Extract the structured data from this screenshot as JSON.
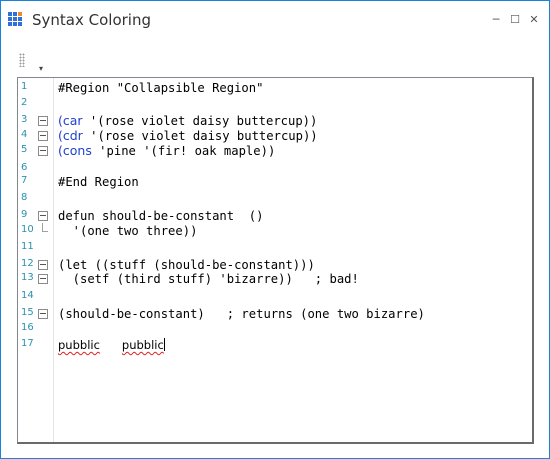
{
  "window": {
    "title": "Syntax Coloring",
    "minimize": "─",
    "maximize": "☐",
    "close": "✕"
  },
  "toolbar": {
    "overflow_icon": "▾"
  },
  "editor": {
    "lines": [
      {
        "n": "1",
        "text": "#Region \"Collapsible Region\""
      },
      {
        "n": "2",
        "text": ""
      },
      {
        "n": "3",
        "kw": "(car",
        "text": " '(rose violet daisy buttercup))"
      },
      {
        "n": "4",
        "kw": "(cdr",
        "text": " '(rose violet daisy buttercup))"
      },
      {
        "n": "5",
        "kw": "(cons",
        "text": " 'pine '(fir! oak maple))"
      },
      {
        "n": "6",
        "text": ""
      },
      {
        "n": "7",
        "text": "#End Region"
      },
      {
        "n": "8",
        "text": ""
      },
      {
        "n": "9",
        "text": "defun should-be-constant  ()"
      },
      {
        "n": "10",
        "text": "  '(one two three))"
      },
      {
        "n": "11",
        "text": ""
      },
      {
        "n": "12",
        "text": "(let ((stuff (should-be-constant)))"
      },
      {
        "n": "13",
        "text": "  (setf (third stuff) 'bizarre))   ; bad!"
      },
      {
        "n": "14",
        "text": ""
      },
      {
        "n": "15",
        "text": "(should-be-constant)   ; returns (one two bizarre)"
      },
      {
        "n": "16",
        "text": ""
      },
      {
        "n": "17",
        "w1": "pubblic",
        "w2": "pubblic"
      }
    ]
  },
  "colors": {
    "line_number": "#2b91af",
    "keyword": "#1f3fd0",
    "spell_error": "#e02020",
    "window_border": "#1883d7"
  }
}
